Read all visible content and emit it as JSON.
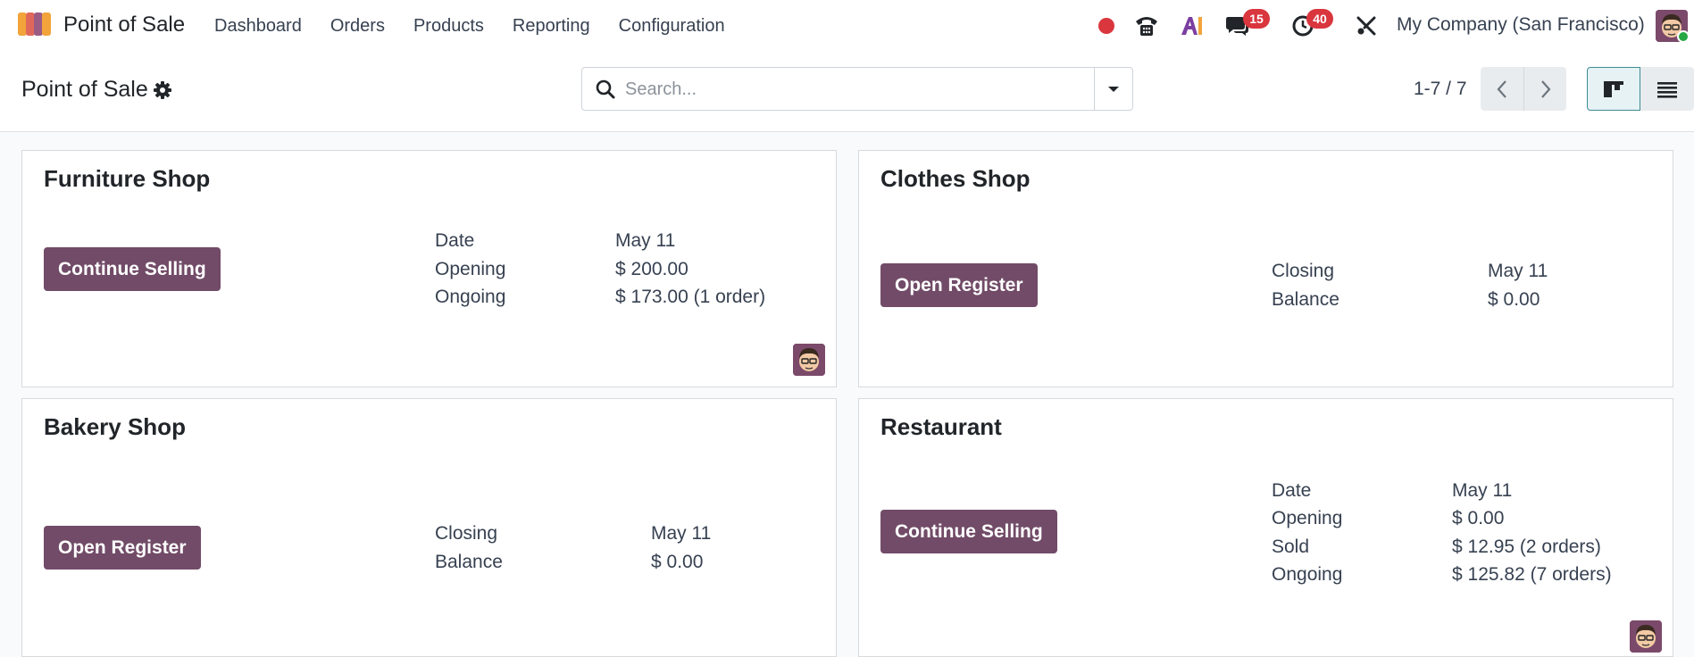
{
  "app": {
    "name": "Point of Sale"
  },
  "menu": [
    "Dashboard",
    "Orders",
    "Products",
    "Reporting",
    "Configuration"
  ],
  "systray": {
    "messages_count": "15",
    "activities_count": "40",
    "company": "My Company (San Francisco)"
  },
  "control": {
    "breadcrumb": "Point of Sale",
    "search_placeholder": "Search...",
    "pager": "1-7 / 7"
  },
  "cards": [
    {
      "title": "Furniture Shop",
      "button": "Continue Selling",
      "rows": [
        {
          "label": "Date",
          "value": "May 11"
        },
        {
          "label": "Opening",
          "value": "$ 200.00"
        },
        {
          "label": "Ongoing",
          "value": "$ 173.00 (1 order)"
        }
      ]
    },
    {
      "title": "Clothes Shop",
      "button": "Open Register",
      "rows": [
        {
          "label": "Closing",
          "value": "May 11"
        },
        {
          "label": "Balance",
          "value": "$ 0.00"
        }
      ]
    },
    {
      "title": "Bakery Shop",
      "button": "Open Register",
      "rows": [
        {
          "label": "Closing",
          "value": "May 11"
        },
        {
          "label": "Balance",
          "value": "$ 0.00"
        }
      ]
    },
    {
      "title": "Restaurant",
      "button": "Continue Selling",
      "rows": [
        {
          "label": "Date",
          "value": "May 11"
        },
        {
          "label": "Opening",
          "value": "$ 0.00"
        },
        {
          "label": "Sold",
          "value": "$ 12.95 (2 orders)"
        },
        {
          "label": "Ongoing",
          "value": "$ 125.82 (7 orders)"
        }
      ]
    }
  ],
  "colors": {
    "primary": "#714b67",
    "badge": "#d9363e",
    "recording": "#d9363e"
  }
}
